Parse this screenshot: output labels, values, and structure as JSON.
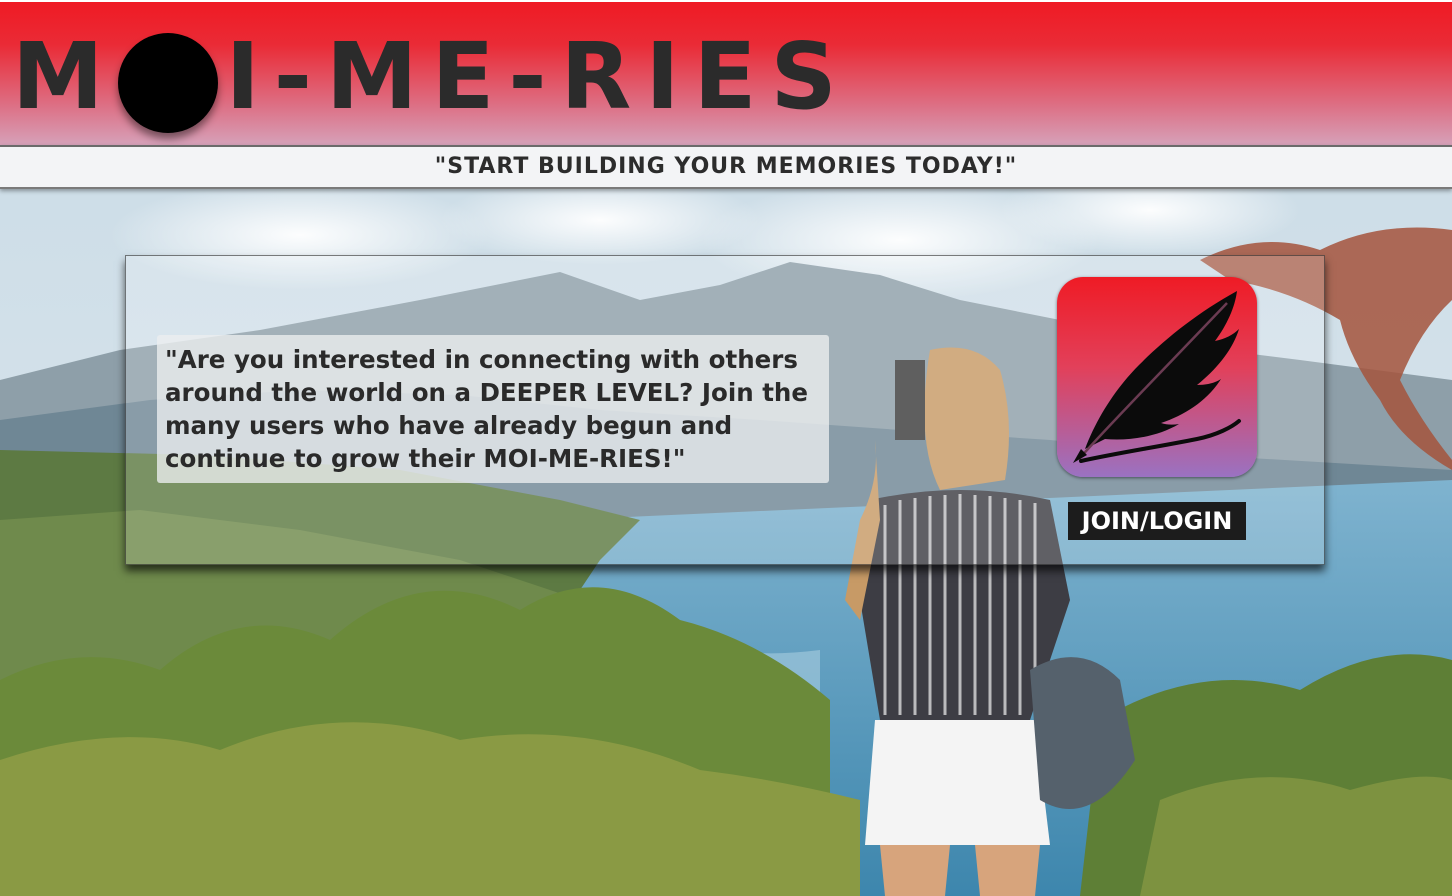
{
  "brand": {
    "logo_prefix": "M",
    "logo_suffix": "I-ME-RIES",
    "logo_mark": "black-circle-logo-icon"
  },
  "tagline": "\"START BUILDING YOUR MEMORIES TODAY!\"",
  "hero": {
    "text": "\"Are you interested in connecting with others around the world on a DEEPER LEVEL? Join the many users who have already begun and continue to grow their MOI-ME-RIES!\"",
    "app_icon": "quill-feather-icon",
    "join_label": "JOIN/LOGIN"
  },
  "colors": {
    "header_red": "#ef1a24",
    "header_pink": "#d6a1b9",
    "icon_purple": "#9a72c2",
    "button_dark": "#1c1c1c"
  }
}
